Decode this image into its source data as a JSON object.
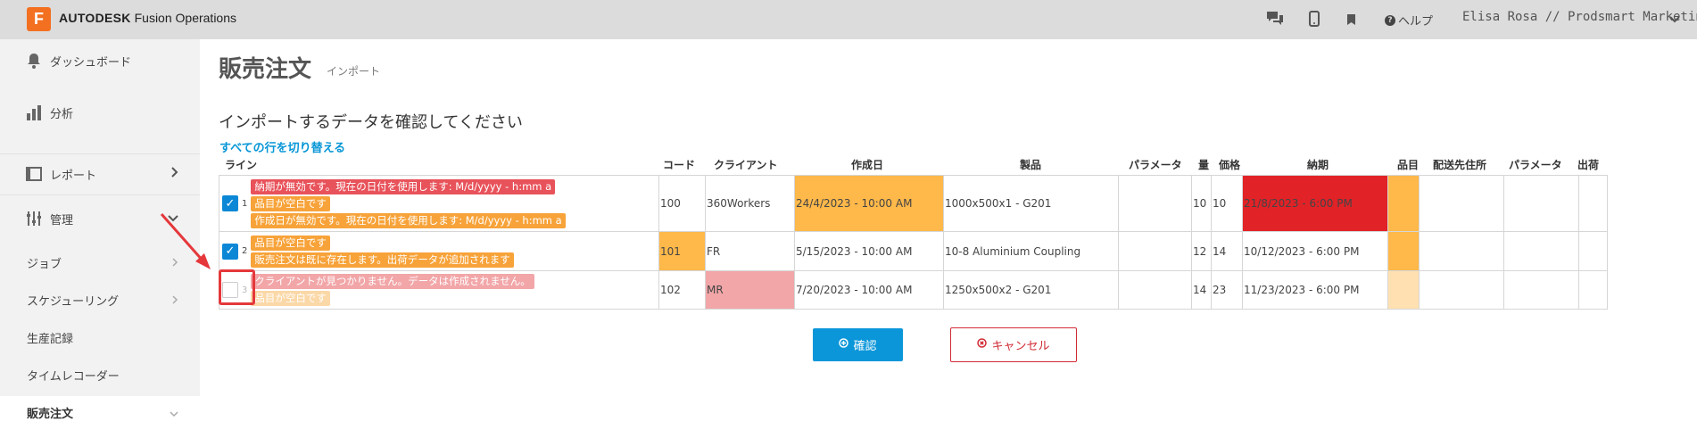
{
  "topbar": {
    "logo_letter": "F",
    "brand_bold": "AUTODESK",
    "brand_rest": " Fusion Operations",
    "help_label": "ヘルプ",
    "user_label": "Elisa Rosa // Prodsmart Marketing",
    "icons": [
      "chat-icon",
      "mobile-icon",
      "bookmark-icon",
      "help-icon",
      "chevron-down-icon"
    ]
  },
  "sidebar": {
    "dashboard": "ダッシュボード",
    "analysis": "分析",
    "reports": "レポート",
    "admin": "管理",
    "sub": {
      "jobs": "ジョブ",
      "scheduling": "スケジューリング",
      "production_records": "生産記録",
      "time_recorder": "タイムレコーダー",
      "sales_orders": "販売注文"
    }
  },
  "main": {
    "title": "販売注文",
    "subtitle": "インポート",
    "confirm_heading": "インポートするデータを確認してください",
    "toggle_all": "すべての行を切り替える"
  },
  "table": {
    "headers": {
      "line": "ライン",
      "code": "コード",
      "client": "クライアント",
      "created": "作成日",
      "product": "製品",
      "params": "パラメータ",
      "qty": "量",
      "price": "価格",
      "due": "納期",
      "item": "品目",
      "ship_to": "配送先住所",
      "params2": "パラメータ",
      "shipping": "出荷"
    },
    "rows": [
      {
        "line": "1",
        "checked": true,
        "errors": [
          "納期が無効です。現在の日付を使用します: M/d/yyyy - h:mm a",
          "品目が空白です",
          "作成日が無効です。現在の日付を使用します: M/d/yyyy - h:mm a"
        ],
        "code": "100",
        "client": "360Workers",
        "created": "24/4/2023 - 10:00 AM",
        "product": "1000x500x1 - G201",
        "params": "",
        "qty": "10",
        "price": "10",
        "due": "21/8/2023 - 6:00 PM"
      },
      {
        "line": "2",
        "checked": true,
        "errors": [
          "品目が空白です",
          "販売注文は既に存在します。出荷データが追加されます"
        ],
        "code": "101",
        "client": "FR",
        "created": "5/15/2023 - 10:00 AM",
        "product": "10-8 Aluminium Coupling",
        "params": "",
        "qty": "12",
        "price": "14",
        "due": "10/12/2023 - 6:00 PM"
      },
      {
        "line": "3",
        "checked": false,
        "errors": [
          "クライアントが見つかりません。データは作成されません。",
          "品目が空白です"
        ],
        "code": "102",
        "client": "MR",
        "created": "7/20/2023 - 10:00 AM",
        "product": "1250x500x2 - G201",
        "params": "",
        "qty": "14",
        "price": "23",
        "due": "11/23/2023 - 6:00 PM"
      }
    ]
  },
  "buttons": {
    "confirm": "確認",
    "cancel": "キャンセル"
  },
  "colors": {
    "accent_blue": "#0b96d9",
    "error_red": "#e8525a",
    "warning_orange": "#f7a33a",
    "cell_orange": "#ffb84a",
    "cell_red": "#e12227",
    "annotation_red": "#e5383b"
  }
}
